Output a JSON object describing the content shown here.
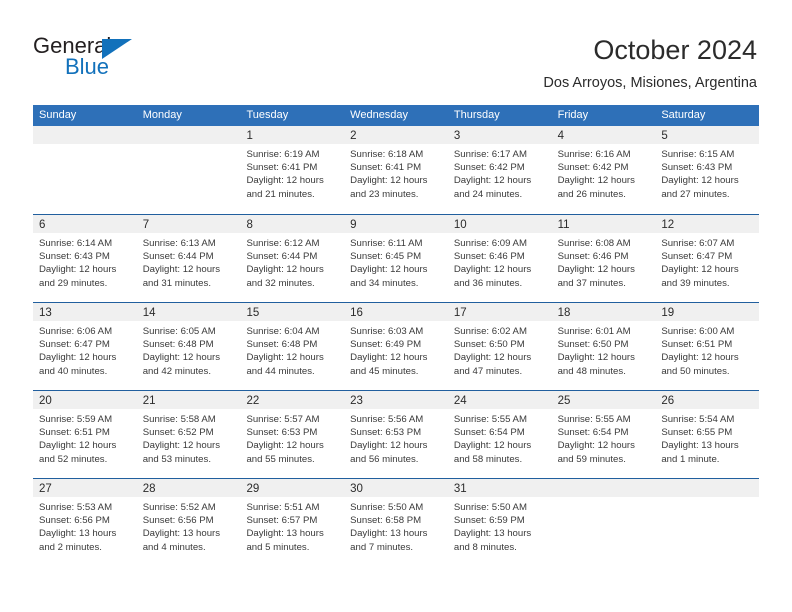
{
  "brand": {
    "name_part1": "General",
    "name_part2": "Blue",
    "triangle_icon": "triangle-icon",
    "accent_color": "#1271bb"
  },
  "header": {
    "title": "October 2024",
    "subtitle": "Dos Arroyos, Misiones, Argentina"
  },
  "theme": {
    "header_blue": "#2e70b8",
    "row_divider_blue": "#215f9e",
    "day_band_gray": "#f0f0f0",
    "text_color": "#3a3a3a"
  },
  "weekdays": [
    "Sunday",
    "Monday",
    "Tuesday",
    "Wednesday",
    "Thursday",
    "Friday",
    "Saturday"
  ],
  "weeks": [
    [
      {
        "empty": true
      },
      {
        "empty": true
      },
      {
        "day": "1",
        "sunrise": "Sunrise: 6:19 AM",
        "sunset": "Sunset: 6:41 PM",
        "daylight1": "Daylight: 12 hours",
        "daylight2": "and 21 minutes."
      },
      {
        "day": "2",
        "sunrise": "Sunrise: 6:18 AM",
        "sunset": "Sunset: 6:41 PM",
        "daylight1": "Daylight: 12 hours",
        "daylight2": "and 23 minutes."
      },
      {
        "day": "3",
        "sunrise": "Sunrise: 6:17 AM",
        "sunset": "Sunset: 6:42 PM",
        "daylight1": "Daylight: 12 hours",
        "daylight2": "and 24 minutes."
      },
      {
        "day": "4",
        "sunrise": "Sunrise: 6:16 AM",
        "sunset": "Sunset: 6:42 PM",
        "daylight1": "Daylight: 12 hours",
        "daylight2": "and 26 minutes."
      },
      {
        "day": "5",
        "sunrise": "Sunrise: 6:15 AM",
        "sunset": "Sunset: 6:43 PM",
        "daylight1": "Daylight: 12 hours",
        "daylight2": "and 27 minutes."
      }
    ],
    [
      {
        "day": "6",
        "sunrise": "Sunrise: 6:14 AM",
        "sunset": "Sunset: 6:43 PM",
        "daylight1": "Daylight: 12 hours",
        "daylight2": "and 29 minutes."
      },
      {
        "day": "7",
        "sunrise": "Sunrise: 6:13 AM",
        "sunset": "Sunset: 6:44 PM",
        "daylight1": "Daylight: 12 hours",
        "daylight2": "and 31 minutes."
      },
      {
        "day": "8",
        "sunrise": "Sunrise: 6:12 AM",
        "sunset": "Sunset: 6:44 PM",
        "daylight1": "Daylight: 12 hours",
        "daylight2": "and 32 minutes."
      },
      {
        "day": "9",
        "sunrise": "Sunrise: 6:11 AM",
        "sunset": "Sunset: 6:45 PM",
        "daylight1": "Daylight: 12 hours",
        "daylight2": "and 34 minutes."
      },
      {
        "day": "10",
        "sunrise": "Sunrise: 6:09 AM",
        "sunset": "Sunset: 6:46 PM",
        "daylight1": "Daylight: 12 hours",
        "daylight2": "and 36 minutes."
      },
      {
        "day": "11",
        "sunrise": "Sunrise: 6:08 AM",
        "sunset": "Sunset: 6:46 PM",
        "daylight1": "Daylight: 12 hours",
        "daylight2": "and 37 minutes."
      },
      {
        "day": "12",
        "sunrise": "Sunrise: 6:07 AM",
        "sunset": "Sunset: 6:47 PM",
        "daylight1": "Daylight: 12 hours",
        "daylight2": "and 39 minutes."
      }
    ],
    [
      {
        "day": "13",
        "sunrise": "Sunrise: 6:06 AM",
        "sunset": "Sunset: 6:47 PM",
        "daylight1": "Daylight: 12 hours",
        "daylight2": "and 40 minutes."
      },
      {
        "day": "14",
        "sunrise": "Sunrise: 6:05 AM",
        "sunset": "Sunset: 6:48 PM",
        "daylight1": "Daylight: 12 hours",
        "daylight2": "and 42 minutes."
      },
      {
        "day": "15",
        "sunrise": "Sunrise: 6:04 AM",
        "sunset": "Sunset: 6:48 PM",
        "daylight1": "Daylight: 12 hours",
        "daylight2": "and 44 minutes."
      },
      {
        "day": "16",
        "sunrise": "Sunrise: 6:03 AM",
        "sunset": "Sunset: 6:49 PM",
        "daylight1": "Daylight: 12 hours",
        "daylight2": "and 45 minutes."
      },
      {
        "day": "17",
        "sunrise": "Sunrise: 6:02 AM",
        "sunset": "Sunset: 6:50 PM",
        "daylight1": "Daylight: 12 hours",
        "daylight2": "and 47 minutes."
      },
      {
        "day": "18",
        "sunrise": "Sunrise: 6:01 AM",
        "sunset": "Sunset: 6:50 PM",
        "daylight1": "Daylight: 12 hours",
        "daylight2": "and 48 minutes."
      },
      {
        "day": "19",
        "sunrise": "Sunrise: 6:00 AM",
        "sunset": "Sunset: 6:51 PM",
        "daylight1": "Daylight: 12 hours",
        "daylight2": "and 50 minutes."
      }
    ],
    [
      {
        "day": "20",
        "sunrise": "Sunrise: 5:59 AM",
        "sunset": "Sunset: 6:51 PM",
        "daylight1": "Daylight: 12 hours",
        "daylight2": "and 52 minutes."
      },
      {
        "day": "21",
        "sunrise": "Sunrise: 5:58 AM",
        "sunset": "Sunset: 6:52 PM",
        "daylight1": "Daylight: 12 hours",
        "daylight2": "and 53 minutes."
      },
      {
        "day": "22",
        "sunrise": "Sunrise: 5:57 AM",
        "sunset": "Sunset: 6:53 PM",
        "daylight1": "Daylight: 12 hours",
        "daylight2": "and 55 minutes."
      },
      {
        "day": "23",
        "sunrise": "Sunrise: 5:56 AM",
        "sunset": "Sunset: 6:53 PM",
        "daylight1": "Daylight: 12 hours",
        "daylight2": "and 56 minutes."
      },
      {
        "day": "24",
        "sunrise": "Sunrise: 5:55 AM",
        "sunset": "Sunset: 6:54 PM",
        "daylight1": "Daylight: 12 hours",
        "daylight2": "and 58 minutes."
      },
      {
        "day": "25",
        "sunrise": "Sunrise: 5:55 AM",
        "sunset": "Sunset: 6:54 PM",
        "daylight1": "Daylight: 12 hours",
        "daylight2": "and 59 minutes."
      },
      {
        "day": "26",
        "sunrise": "Sunrise: 5:54 AM",
        "sunset": "Sunset: 6:55 PM",
        "daylight1": "Daylight: 13 hours",
        "daylight2": "and 1 minute."
      }
    ],
    [
      {
        "day": "27",
        "sunrise": "Sunrise: 5:53 AM",
        "sunset": "Sunset: 6:56 PM",
        "daylight1": "Daylight: 13 hours",
        "daylight2": "and 2 minutes."
      },
      {
        "day": "28",
        "sunrise": "Sunrise: 5:52 AM",
        "sunset": "Sunset: 6:56 PM",
        "daylight1": "Daylight: 13 hours",
        "daylight2": "and 4 minutes."
      },
      {
        "day": "29",
        "sunrise": "Sunrise: 5:51 AM",
        "sunset": "Sunset: 6:57 PM",
        "daylight1": "Daylight: 13 hours",
        "daylight2": "and 5 minutes."
      },
      {
        "day": "30",
        "sunrise": "Sunrise: 5:50 AM",
        "sunset": "Sunset: 6:58 PM",
        "daylight1": "Daylight: 13 hours",
        "daylight2": "and 7 minutes."
      },
      {
        "day": "31",
        "sunrise": "Sunrise: 5:50 AM",
        "sunset": "Sunset: 6:59 PM",
        "daylight1": "Daylight: 13 hours",
        "daylight2": "and 8 minutes."
      },
      {
        "empty": true
      },
      {
        "empty": true
      }
    ]
  ]
}
